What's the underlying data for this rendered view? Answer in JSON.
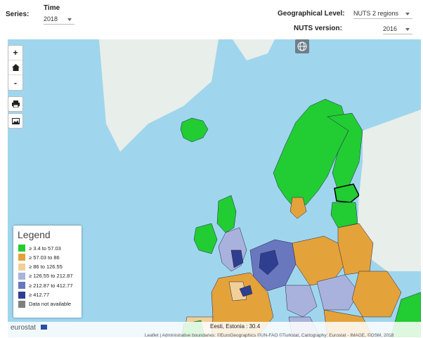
{
  "toolbar": {
    "series_label": "Series:",
    "time_label": "Time",
    "time_value": "2018",
    "geo_label": "Geographical Level:",
    "geo_value": "NUTS 2 regions",
    "nuts_label": "NUTS version:",
    "nuts_value": "2016"
  },
  "map_controls": {
    "zoom_in": "+",
    "zoom_out": "-"
  },
  "legend": {
    "title": "Legend",
    "items": [
      {
        "label": "≥ 3.4 to 57.03",
        "color": "#22cc33"
      },
      {
        "label": "≥ 57.03 to 86",
        "color": "#e4a23a"
      },
      {
        "label": "≥ 86 to 126.55",
        "color": "#f1cf98"
      },
      {
        "label": "≥ 126.55 to 212.87",
        "color": "#a9b2dc"
      },
      {
        "label": "≥ 212.87 to 412.77",
        "color": "#6977bf"
      },
      {
        "label": "≥ 412.77",
        "color": "#2f3e8f"
      },
      {
        "label": "Data not available",
        "color": "#808080"
      }
    ]
  },
  "footer": {
    "brand": "eurostat",
    "status": "Eesti, Estonia : 30.4",
    "attribution": "Leaflet | Administrative boundaries: ©EuroGeographics ©UN-FAO ©Turkstat, Cartography: Eurostat - IMAGE, ©OSM, 2018"
  },
  "colors": {
    "sea": "#9fd6ee",
    "land_outside": "#e8eee9",
    "low": "#22cc33",
    "mid": "#e4a23a",
    "midlight": "#f1cf98",
    "high_light": "#a9b2dc",
    "high": "#6977bf",
    "highest": "#2f3e8f"
  }
}
